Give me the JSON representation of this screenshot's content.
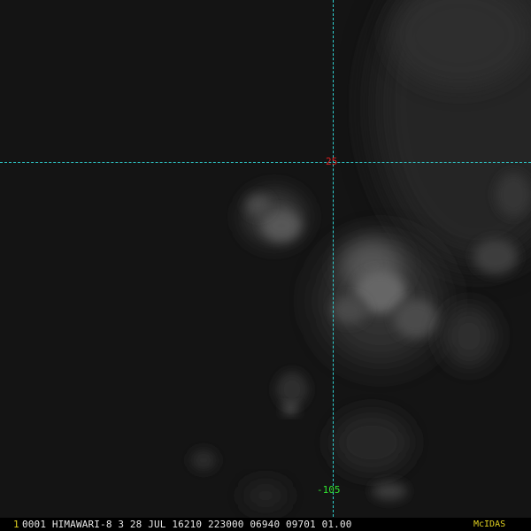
{
  "satellite_view": {
    "grid": {
      "latitude_label": "25",
      "longitude_label": "-105",
      "line_color": "#2fd0d0",
      "latitude_label_color": "#e02020",
      "longitude_label_color": "#30e030"
    },
    "caption": {
      "frame_number": "1",
      "text": "0001 HIMAWARI-8   3 28 JUL 16210 223000 06940 09701 01.00",
      "brand": "McIDAS",
      "frame_number_color": "#e0d020",
      "brand_color": "#e0d020"
    }
  }
}
